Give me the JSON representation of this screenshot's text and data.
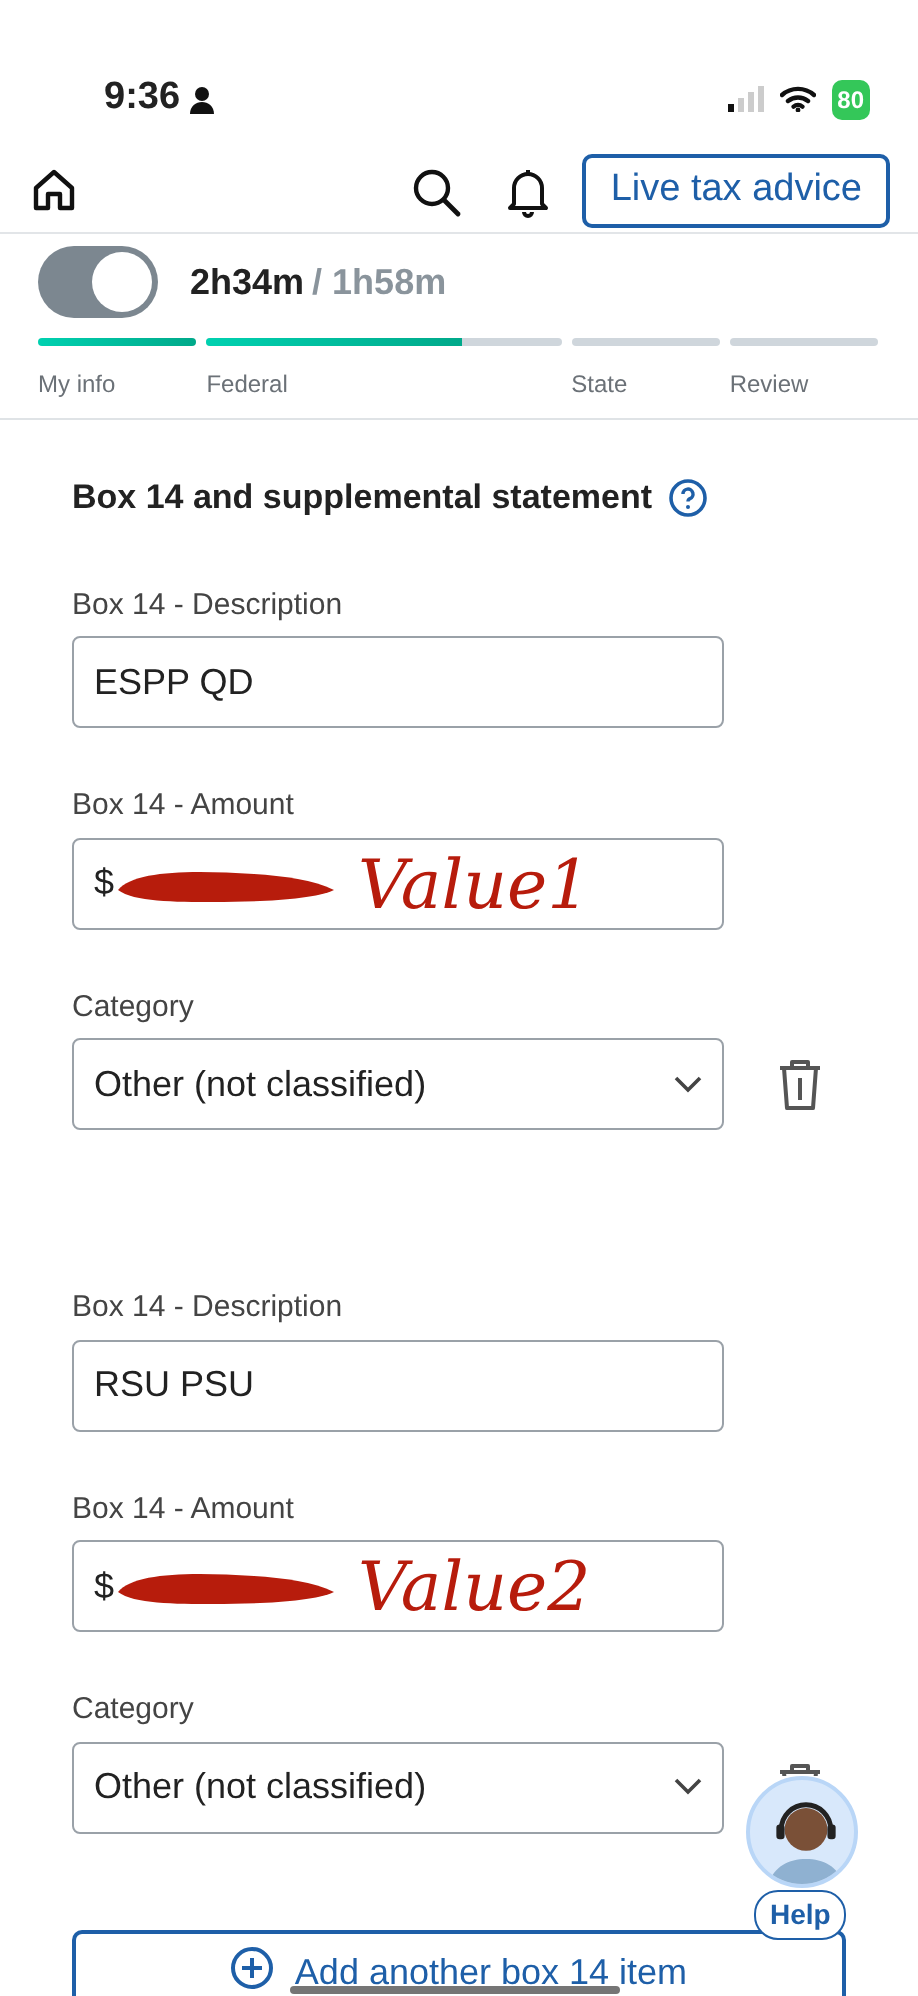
{
  "status_bar": {
    "time": "9:36",
    "battery": "80"
  },
  "top_bar": {
    "advice_button": "Live tax advice"
  },
  "timer": {
    "on": true,
    "elapsed": "2h34m",
    "estimate": "/ 1h58m"
  },
  "progress": [
    {
      "label": "My info",
      "level": 1
    },
    {
      "label": "Federal",
      "level": 0.72
    },
    {
      "label": "State",
      "level": 0
    },
    {
      "label": "Review",
      "level": 0
    }
  ],
  "section": {
    "title": "Box 14 and supplemental statement"
  },
  "items": [
    {
      "description_label": "Box 14 - Description",
      "description": "ESPP QD",
      "amount_label": "Box 14 - Amount",
      "amount": "$",
      "redacted": true,
      "note": "Value1",
      "category_label": "Category",
      "category": "Other (not classified)"
    },
    {
      "description_label": "Box 14 - Description",
      "description": "RSU PSU",
      "amount_label": "Box 14 - Amount",
      "amount": "$",
      "redacted": true,
      "note": "Value2",
      "category_label": "Category",
      "category": "Other (not classified)"
    }
  ],
  "help_bubble": {
    "label": "Help"
  },
  "add_button": "Add another box 14 item"
}
